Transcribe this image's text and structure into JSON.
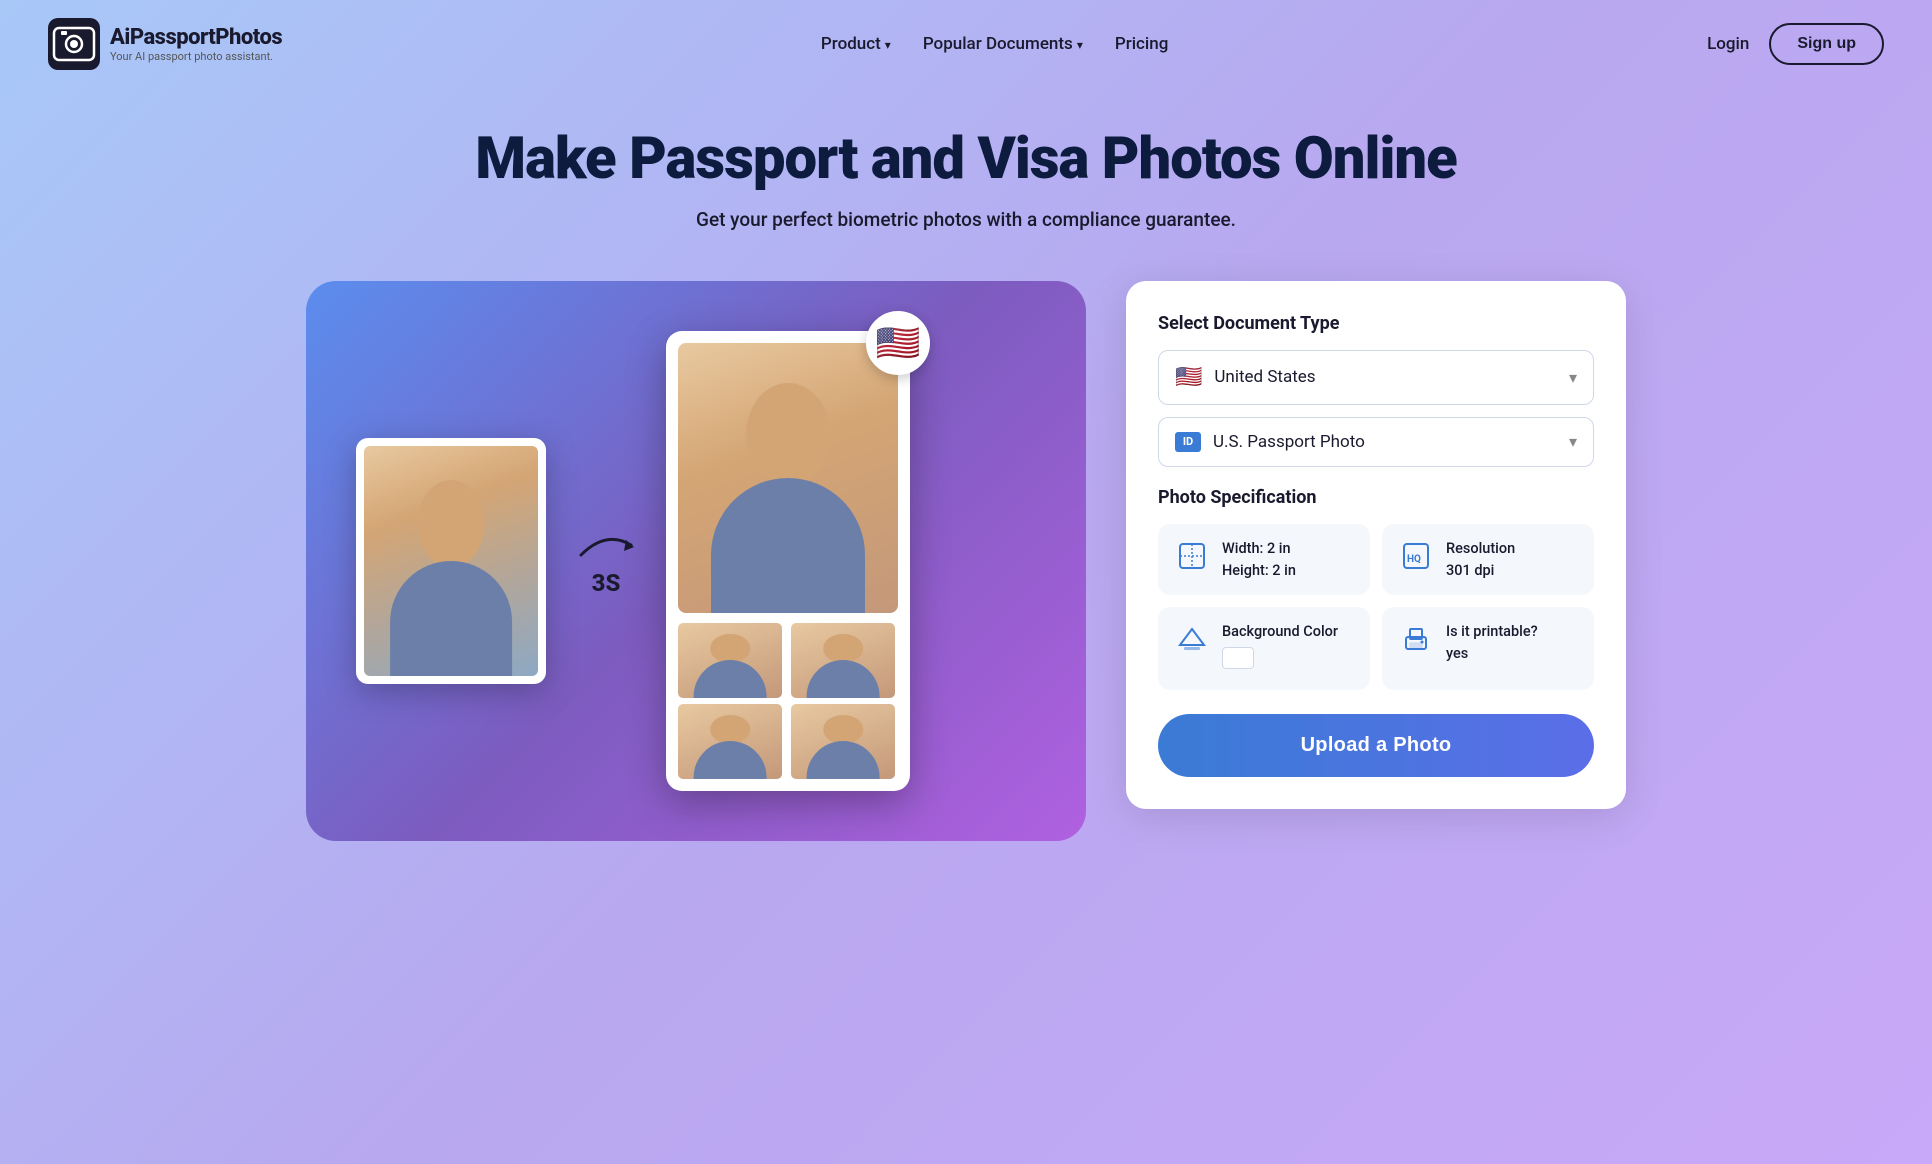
{
  "brand": {
    "name": "AiPassportPhotos",
    "tagline": "Your AI passport photo assistant.",
    "logo_alt": "camera-logo"
  },
  "nav": {
    "product_label": "Product",
    "popular_label": "Popular Documents",
    "pricing_label": "Pricing",
    "login_label": "Login",
    "signup_label": "Sign up"
  },
  "hero": {
    "headline": "Make Passport and Visa Photos Online",
    "subheadline": "Get your perfect biometric photos with a compliance guarantee."
  },
  "illustration": {
    "arrow_label": "3S",
    "flag_emoji": "🇺🇸"
  },
  "panel": {
    "select_doc_title": "Select Document Type",
    "country_label": "United States",
    "country_flag": "🇺🇸",
    "document_type_label": "U.S. Passport Photo",
    "document_icon_text": "ID",
    "photo_spec_title": "Photo Specification",
    "spec_width_label": "Width: 2 in",
    "spec_height_label": "Height: 2 in",
    "spec_resolution_line1": "Resolution",
    "spec_resolution_line2": "301 dpi",
    "spec_bg_label": "Background Color",
    "spec_printable_line1": "Is it printable?",
    "spec_printable_line2": "yes",
    "upload_button_label": "Upload a Photo"
  },
  "colors": {
    "accent_blue": "#3a7bd5",
    "background_swatch": "#ffffff"
  }
}
